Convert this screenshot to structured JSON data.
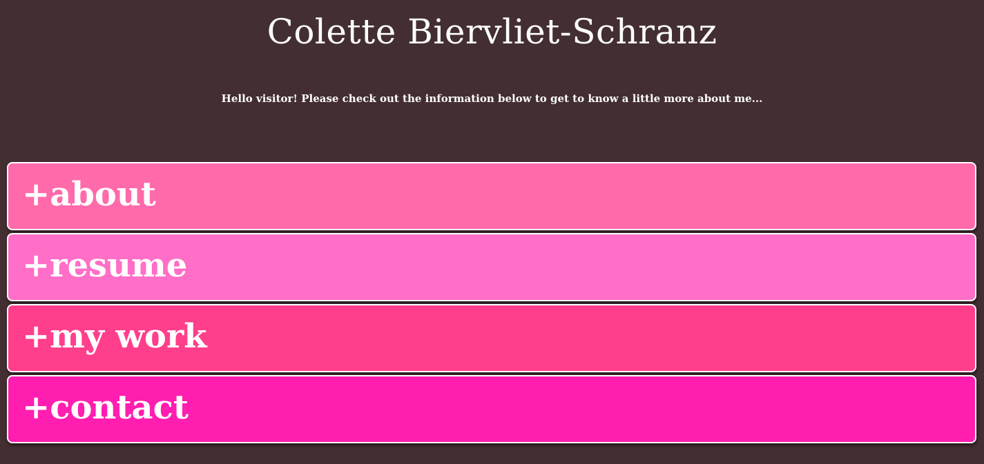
{
  "header": {
    "title": "Colette Biervliet-Schranz",
    "intro": "Hello visitor! Please check out the information below to get to know a little more about me..."
  },
  "sections": [
    {
      "label": "+about",
      "color": "#ff6aab"
    },
    {
      "label": "+resume",
      "color": "#ff6ec7"
    },
    {
      "label": "+my work",
      "color": "#ff3f8c"
    },
    {
      "label": "+contact",
      "color": "#ff1eb0"
    }
  ],
  "colors": {
    "background": "#432e31",
    "text": "#ffffff",
    "section_border": "#ffffff"
  }
}
